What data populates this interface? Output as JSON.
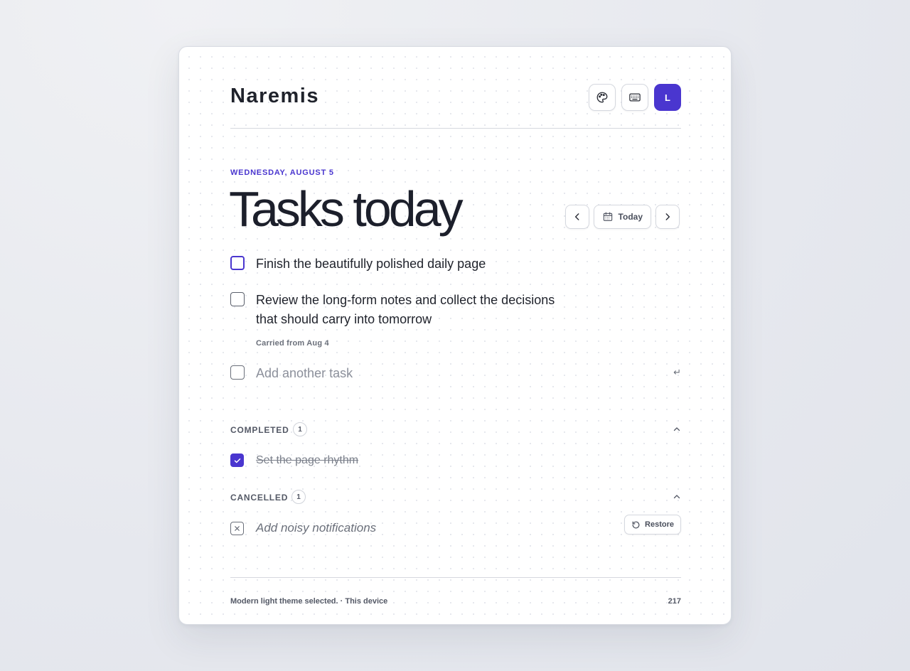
{
  "app": {
    "name": "Naremis",
    "avatar_initial": "L"
  },
  "header": {
    "buttons": [
      {
        "name": "theme",
        "icon": "palette-icon"
      },
      {
        "name": "shortcuts",
        "icon": "keyboard-icon"
      }
    ]
  },
  "page": {
    "date": "WEDNESDAY, AUGUST 5",
    "title": "Tasks today",
    "today_label": "Today"
  },
  "tasks": [
    {
      "text": "Finish the beautifully polished daily page",
      "meta": ""
    },
    {
      "text": "Review the long-form notes and collect the decisions that should carry into tomorrow",
      "meta": "Carried from Aug 4"
    }
  ],
  "add_task": {
    "placeholder": "Add another task",
    "enter_glyph": "↵"
  },
  "completed": {
    "label": "COMPLETED",
    "count": "1",
    "items": [
      {
        "text": "Set the page rhythm"
      }
    ]
  },
  "cancelled": {
    "label": "CANCELLED",
    "count": "1",
    "items": [
      {
        "text": "Add noisy notifications",
        "action": "Restore"
      }
    ]
  },
  "footer": {
    "status": "Modern light theme selected. · This device",
    "count": "217"
  },
  "colors": {
    "accent": "#4a36cf",
    "text": "#1c1f2b",
    "muted": "#6a6f7a"
  }
}
